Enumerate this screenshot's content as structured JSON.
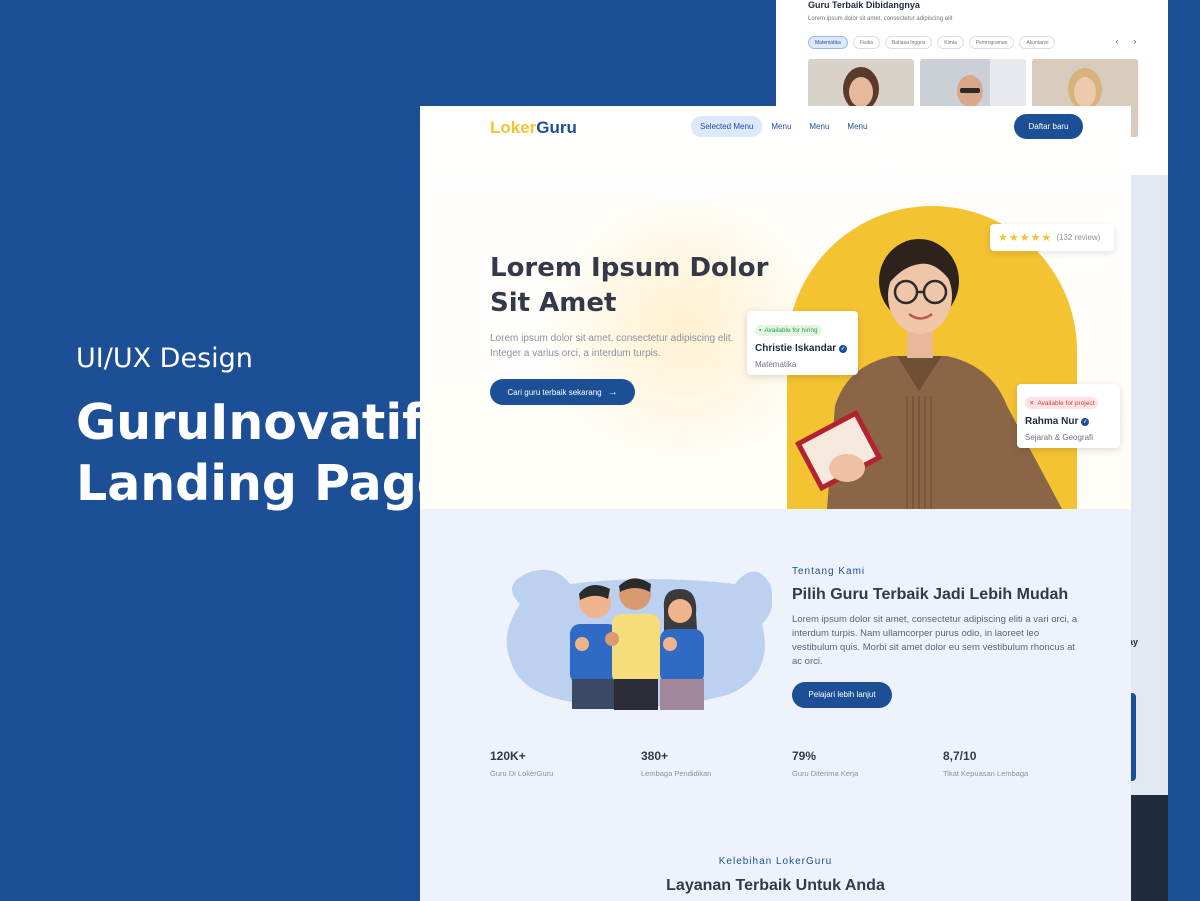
{
  "side": {
    "kicker": "UI/UX Design",
    "title_line1": "GuruInovatif",
    "title_line2": "Landing Page"
  },
  "back_card": {
    "title": "Guru Terbaik Dibidangnya",
    "subtitle": "Lorem ipsum dolor sit amet, consectetur adipiscing elit",
    "chips": [
      "Matematika",
      "Fisika",
      "Bahasa Inggris",
      "Kimia",
      "Pemrograman",
      "Akuntansi"
    ],
    "arrow_prev": "‹",
    "arrow_next": "›",
    "day_text": "ay"
  },
  "header": {
    "logo_part1": "Loker",
    "logo_part2": "Guru",
    "nav": [
      "Selected Menu",
      "Menu",
      "Menu",
      "Menu"
    ],
    "signup_label": "Daftar baru"
  },
  "hero": {
    "title_line1": "Lorem Ipsum Dolor",
    "title_line2": "Sit Amet",
    "description": "Lorem ipsum dolor sit amet, consectetur adipiscing elit. Integer a varius orci, a interdum turpis.",
    "cta_label": "Cari guru terbaik sekarang",
    "review": {
      "stars": "★★★★★",
      "count": "(132 review)"
    },
    "cards": [
      {
        "badge": "Available for hiring",
        "name": "Christie Iskandar",
        "subject": "Matematika",
        "status_color": "#2f9a44"
      },
      {
        "badge": "Available for project",
        "name": "Rahma Nur",
        "subject": "Sejarah & Geografi",
        "status_color": "#d0413a"
      }
    ]
  },
  "about": {
    "label": "Tentang Kami",
    "title": "Pilih Guru Terbaik Jadi Lebih Mudah",
    "description": "Lorem ipsum dolor sit amet, consectetur adipiscing eliti a vari orci, a interdum turpis. Nam ullamcorper purus odio, in laoreet leo vestibulum quis. Morbi sit amet dolor eu sem vestibulum rhoncus at ac orci.",
    "cta_label": "Pelajari lebih lanjut"
  },
  "stats": [
    {
      "value": "120K+",
      "label": "Guru Di LokerGuru"
    },
    {
      "value": "380+",
      "label": "Lembaga Pendidikan"
    },
    {
      "value": "79%",
      "label": "Guru Diterima Kerja"
    },
    {
      "value": "8,7/10",
      "label": "Tikat Kepuasan Lembaga"
    }
  ],
  "advantages": {
    "label": "Kelebihan LokerGuru",
    "title": "Layanan Terbaik Untuk Anda"
  },
  "colors": {
    "brand_blue": "#1c4f96",
    "brand_yellow": "#f4c331"
  }
}
